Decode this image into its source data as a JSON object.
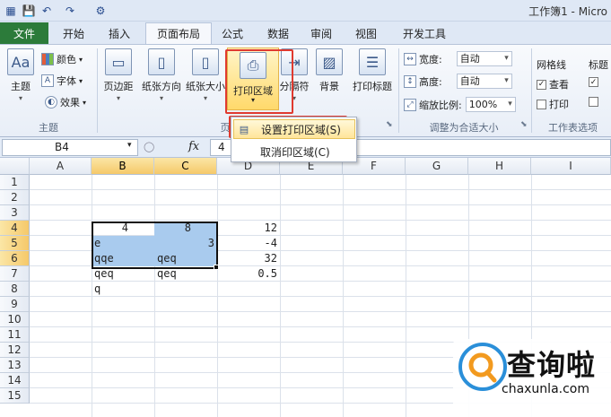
{
  "app": {
    "title": "工作簿1 - Micro"
  },
  "tabs": [
    {
      "label": "文件"
    },
    {
      "label": "开始"
    },
    {
      "label": "插入"
    },
    {
      "label": "页面布局"
    },
    {
      "label": "公式"
    },
    {
      "label": "数据"
    },
    {
      "label": "审阅"
    },
    {
      "label": "视图"
    },
    {
      "label": "开发工具"
    }
  ],
  "ribbon": {
    "theme": {
      "main": "主题",
      "colors": "颜色",
      "fonts": "字体",
      "effects": "效果",
      "group": "主题"
    },
    "page_setup": {
      "margins": "页边距",
      "orientation": "纸张方向",
      "size": "纸张大小",
      "print_area": "打印区域",
      "breaks": "分隔符",
      "background": "背景",
      "print_titles": "打印标题",
      "group_partial": "页"
    },
    "scale": {
      "width_label": "宽度:",
      "width_value": "自动",
      "height_label": "高度:",
      "height_value": "自动",
      "scale_label": "缩放比例:",
      "scale_value": "100%",
      "group": "调整为合适大小"
    },
    "sheet_options": {
      "gridlines": "网格线",
      "headings": "标题",
      "view": "查看",
      "print": "打印",
      "group": "工作表选项"
    }
  },
  "menu": {
    "set_print_area": "设置打印区域(S)",
    "clear_print_area": "取消印区域(C)"
  },
  "formula_bar": {
    "name_box": "B4",
    "fx": "fx",
    "value": "4"
  },
  "columns": [
    "A",
    "B",
    "C",
    "D",
    "E",
    "F",
    "G",
    "H",
    "I"
  ],
  "rows": [
    "1",
    "2",
    "3",
    "4",
    "5",
    "6",
    "7",
    "8",
    "9",
    "10",
    "11",
    "12",
    "13",
    "14",
    "15"
  ],
  "cells": {
    "B4": "4",
    "C4": "8",
    "D4": "12",
    "B5": "e",
    "C5": "3",
    "D5": "-4",
    "B6": "qqe",
    "C6": "qeq",
    "D6": "32",
    "B7": "qeq",
    "C7": "qeq",
    "D7": "0.5",
    "B8": "q"
  },
  "watermark": {
    "cn": "查询啦",
    "en": "chaxunla.com"
  },
  "colors": {
    "accent_red": "#e03a2f",
    "selection": "#a9cbee",
    "file_tab": "#2c7b3a"
  }
}
